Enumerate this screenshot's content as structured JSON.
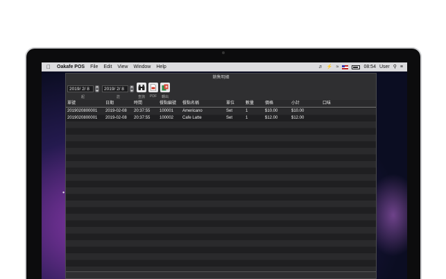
{
  "menubar": {
    "app_name": "Oakafe POS",
    "menus": [
      "File",
      "Edit",
      "View",
      "Window",
      "Help"
    ],
    "clock": "08:54",
    "user": "User"
  },
  "window": {
    "title": "銷售明細"
  },
  "toolbar": {
    "start_date": "2019/ 2/ 8",
    "start_label": "起",
    "end_date": "2019/ 2/ 8",
    "end_label": "訖",
    "query_label": "查詢",
    "pdf_label": "PDF",
    "export_label": "轉出"
  },
  "table": {
    "columns": [
      "單號",
      "日期",
      "時間",
      "餐點編號",
      "餐點名稱",
      "單位",
      "數量",
      "價格",
      "小計",
      "口味"
    ],
    "rows": [
      [
        "2019020800001",
        "2019-02-08",
        "20:37:55",
        "100001",
        "Americano",
        "Set",
        "1",
        "$10.00",
        "$10.00",
        ""
      ],
      [
        "2019020800001",
        "2019-02-08",
        "20:37:55",
        "100002",
        "Cafe Latte",
        "Set",
        "1",
        "$12.00",
        "$12.00",
        ""
      ]
    ]
  },
  "colors": {
    "window_bg": "#2f2f31",
    "table_row_a": "#2a2a2c",
    "table_row_b": "#1f1f21",
    "menubar_bg": "#dcdcde"
  }
}
